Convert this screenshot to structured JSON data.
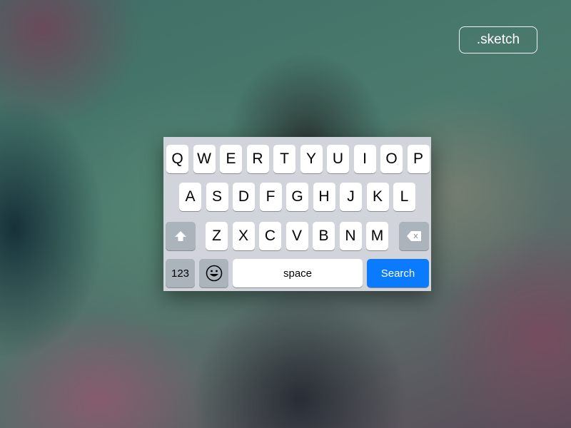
{
  "badge": {
    "label": ".sketch"
  },
  "keyboard": {
    "row1": [
      "Q",
      "W",
      "E",
      "R",
      "T",
      "Y",
      "U",
      "I",
      "O",
      "P"
    ],
    "row2": [
      "A",
      "S",
      "D",
      "F",
      "G",
      "H",
      "J",
      "K",
      "L"
    ],
    "row3": [
      "Z",
      "X",
      "C",
      "V",
      "B",
      "N",
      "M"
    ],
    "shift_icon": "shift-arrow-up-icon",
    "delete_icon": "backspace-icon",
    "numbers_label": "123",
    "emoji_icon": "emoji-smiley-icon",
    "space_label": "space",
    "search_label": "Search"
  },
  "colors": {
    "keyboard_bg": "#d1d5db",
    "key_bg": "#ffffff",
    "function_key_bg": "#abb3bb",
    "accent": "#0a7aff"
  }
}
